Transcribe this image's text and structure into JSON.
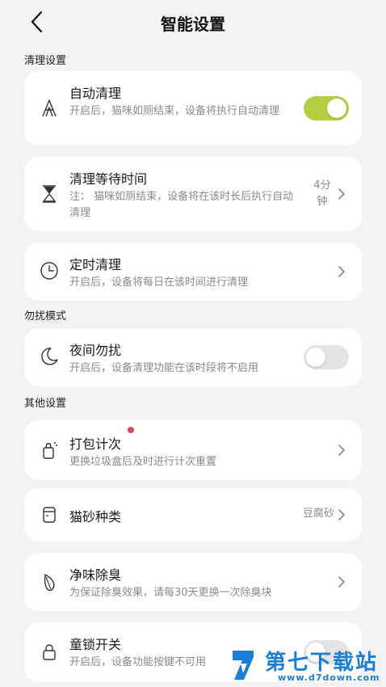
{
  "header": {
    "title": "智能设置"
  },
  "sections": {
    "clean": "清理设置",
    "dnd": "勿扰模式",
    "other": "其他设置"
  },
  "auto_clean": {
    "title": "自动清理",
    "desc": "开启后，猫咪如厕结束，设备将执行自动清理",
    "enabled": true
  },
  "wait_time": {
    "title": "清理等待时间",
    "desc": "注：  猫咪如厕结束，设备将在该时长后执行自动清理",
    "value": "4分钟"
  },
  "timer_clean": {
    "title": "定时清理",
    "desc": "开启后，设备将每日在该时间进行清理"
  },
  "night_dnd": {
    "title": "夜间勿扰",
    "desc": "开启后，设备清理功能在该时段将不启用",
    "enabled": false
  },
  "pack_count": {
    "title": "打包计次",
    "desc": "更换垃圾盒后及时进行计次重置",
    "has_badge": true
  },
  "litter_type": {
    "title": "猫砂种类",
    "value": "豆腐砂"
  },
  "deodorize": {
    "title": "净味除臭",
    "desc": "为保证除臭效果，请每30天更换一次除臭块"
  },
  "child_lock": {
    "title": "童锁开关",
    "desc": "开启后，设备功能按键不可用",
    "enabled": false
  },
  "colors": {
    "accent": "#b3cf3f",
    "badge": "#e2455c",
    "watermark": "#1a7fd4"
  },
  "watermark": {
    "brand": "第七下载站",
    "url": "www.d7down.com"
  }
}
